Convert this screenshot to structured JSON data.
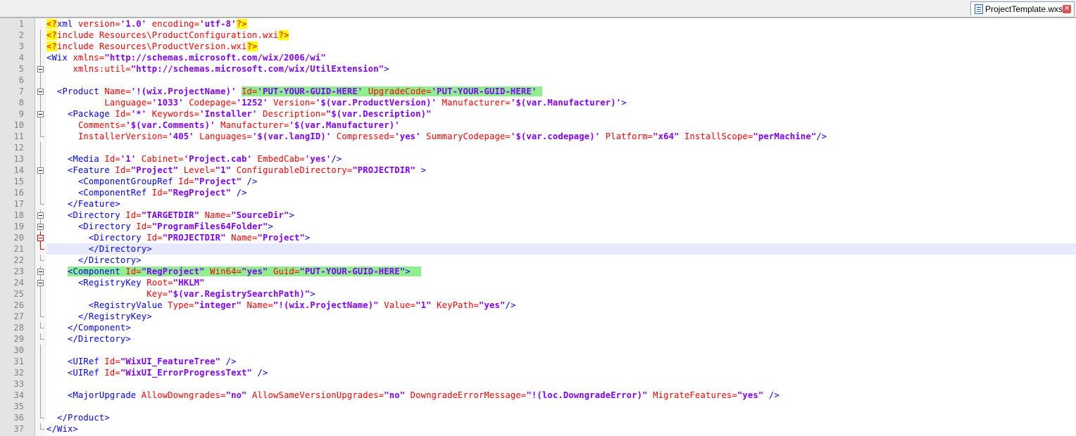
{
  "tab": {
    "filename": "ProjectTemplate.wxs",
    "file_icon": "document-icon",
    "close_icon": "close-icon"
  },
  "colors": {
    "tag": "#0000ff",
    "attribute": "#ff0000",
    "value": "#8000ff",
    "pi_background": "#ffff00",
    "highlight": "#90ee90",
    "current_line": "#e8e8ff"
  },
  "current_line": 21,
  "lines": [
    {
      "n": "1",
      "fold": "none",
      "indent": "",
      "tokens": [
        {
          "t": "<?",
          "c": "pi"
        },
        {
          "t": "xml ",
          "c": "tag"
        },
        {
          "t": "version=",
          "c": "attr"
        },
        {
          "t": "'1.0'",
          "c": "val"
        },
        {
          "t": " encoding=",
          "c": "attr"
        },
        {
          "t": "'utf-8'",
          "c": "val"
        },
        {
          "t": "?>",
          "c": "pi"
        }
      ]
    },
    {
      "n": "2",
      "fold": "none",
      "indent": "",
      "tokens": [
        {
          "t": "<?",
          "c": "pi"
        },
        {
          "t": "include Resources\\ProductConfiguration.wxi",
          "c": "attr"
        },
        {
          "t": "?>",
          "c": "pi"
        }
      ]
    },
    {
      "n": "3",
      "fold": "none",
      "indent": "",
      "tokens": [
        {
          "t": "<?",
          "c": "pi"
        },
        {
          "t": "include Resources\\ProductVersion.wxi",
          "c": "attr"
        },
        {
          "t": "?>",
          "c": "pi"
        }
      ]
    },
    {
      "n": "4",
      "fold": "none",
      "indent": "",
      "tokens": [
        {
          "t": "<Wix ",
          "c": "tag"
        },
        {
          "t": "xmlns=",
          "c": "attr"
        },
        {
          "t": "\"http://schemas.microsoft.com/wix/2006/wi\"",
          "c": "val"
        }
      ]
    },
    {
      "n": "5",
      "fold": "box",
      "indent": "     ",
      "tokens": [
        {
          "t": "xmlns:util=",
          "c": "attr"
        },
        {
          "t": "\"http://schemas.microsoft.com/wix/UtilExtension\"",
          "c": "val"
        },
        {
          "t": ">",
          "c": "tag"
        }
      ]
    },
    {
      "n": "6",
      "fold": "line",
      "indent": "",
      "tokens": []
    },
    {
      "n": "7",
      "fold": "box",
      "indent": "  ",
      "tokens": [
        {
          "t": "<Product ",
          "c": "tag"
        },
        {
          "t": "Name=",
          "c": "attr"
        },
        {
          "t": "'!(wix.ProjectName)'",
          "c": "val"
        },
        {
          "t": " ",
          "c": "txt"
        },
        {
          "t": "Id=",
          "c": "attr",
          "hl": true
        },
        {
          "t": "'PUT-YOUR-GUID-HERE'",
          "c": "val",
          "hl": true
        },
        {
          "t": " UpgradeCode=",
          "c": "attr",
          "hl": true
        },
        {
          "t": "'PUT-YOUR-GUID-HERE'",
          "c": "val",
          "hl": true
        },
        {
          "t": " ",
          "c": "txt",
          "hl": true
        }
      ]
    },
    {
      "n": "8",
      "fold": "line",
      "indent": "           ",
      "tokens": [
        {
          "t": "Language=",
          "c": "attr"
        },
        {
          "t": "'1033'",
          "c": "val"
        },
        {
          "t": " Codepage=",
          "c": "attr"
        },
        {
          "t": "'1252'",
          "c": "val"
        },
        {
          "t": " Version=",
          "c": "attr"
        },
        {
          "t": "'$(var.ProductVersion)'",
          "c": "val"
        },
        {
          "t": " Manufacturer=",
          "c": "attr"
        },
        {
          "t": "'$(var.Manufacturer)'",
          "c": "val"
        },
        {
          "t": ">",
          "c": "tag"
        }
      ]
    },
    {
      "n": "9",
      "fold": "box",
      "indent": "    ",
      "tokens": [
        {
          "t": "<Package ",
          "c": "tag"
        },
        {
          "t": "Id=",
          "c": "attr"
        },
        {
          "t": "'*'",
          "c": "val"
        },
        {
          "t": " Keywords=",
          "c": "attr"
        },
        {
          "t": "'Installer'",
          "c": "val"
        },
        {
          "t": " Description=",
          "c": "attr"
        },
        {
          "t": "\"$(var.Description)\"",
          "c": "val"
        }
      ]
    },
    {
      "n": "10",
      "fold": "line",
      "indent": "      ",
      "tokens": [
        {
          "t": "Comments=",
          "c": "attr"
        },
        {
          "t": "'$(var.Comments)'",
          "c": "val"
        },
        {
          "t": " Manufacturer=",
          "c": "attr"
        },
        {
          "t": "'$(var.Manufacturer)'",
          "c": "val"
        }
      ]
    },
    {
      "n": "11",
      "fold": "end",
      "indent": "      ",
      "tokens": [
        {
          "t": "InstallerVersion=",
          "c": "attr"
        },
        {
          "t": "'405'",
          "c": "val"
        },
        {
          "t": " Languages=",
          "c": "attr"
        },
        {
          "t": "'$(var.langID)'",
          "c": "val"
        },
        {
          "t": " Compressed=",
          "c": "attr"
        },
        {
          "t": "'yes'",
          "c": "val"
        },
        {
          "t": " SummaryCodepage=",
          "c": "attr"
        },
        {
          "t": "'$(var.codepage)'",
          "c": "val"
        },
        {
          "t": " Platform=",
          "c": "attr"
        },
        {
          "t": "\"x64\"",
          "c": "val"
        },
        {
          "t": " InstallScope=",
          "c": "attr"
        },
        {
          "t": "\"perMachine\"",
          "c": "val"
        },
        {
          "t": "/>",
          "c": "tag"
        }
      ]
    },
    {
      "n": "12",
      "fold": "line",
      "indent": "",
      "tokens": []
    },
    {
      "n": "13",
      "fold": "line",
      "indent": "    ",
      "tokens": [
        {
          "t": "<Media ",
          "c": "tag"
        },
        {
          "t": "Id=",
          "c": "attr"
        },
        {
          "t": "'1'",
          "c": "val"
        },
        {
          "t": " Cabinet=",
          "c": "attr"
        },
        {
          "t": "'Project.cab'",
          "c": "val"
        },
        {
          "t": " EmbedCab=",
          "c": "attr"
        },
        {
          "t": "'yes'",
          "c": "val"
        },
        {
          "t": "/>",
          "c": "tag"
        }
      ]
    },
    {
      "n": "14",
      "fold": "box",
      "indent": "    ",
      "tokens": [
        {
          "t": "<Feature ",
          "c": "tag"
        },
        {
          "t": "Id=",
          "c": "attr"
        },
        {
          "t": "\"Project\"",
          "c": "val"
        },
        {
          "t": " Level=",
          "c": "attr"
        },
        {
          "t": "\"1\"",
          "c": "val"
        },
        {
          "t": " ConfigurableDirectory=",
          "c": "attr"
        },
        {
          "t": "\"PROJECTDIR\"",
          "c": "val"
        },
        {
          "t": " >",
          "c": "tag"
        }
      ]
    },
    {
      "n": "15",
      "fold": "line",
      "indent": "      ",
      "tokens": [
        {
          "t": "<ComponentGroupRef ",
          "c": "tag"
        },
        {
          "t": "Id=",
          "c": "attr"
        },
        {
          "t": "\"Project\"",
          "c": "val"
        },
        {
          "t": " />",
          "c": "tag"
        }
      ]
    },
    {
      "n": "16",
      "fold": "line",
      "indent": "      ",
      "tokens": [
        {
          "t": "<ComponentRef ",
          "c": "tag"
        },
        {
          "t": "Id=",
          "c": "attr"
        },
        {
          "t": "\"RegProject\"",
          "c": "val"
        },
        {
          "t": " />",
          "c": "tag"
        }
      ]
    },
    {
      "n": "17",
      "fold": "end",
      "indent": "    ",
      "tokens": [
        {
          "t": "</Feature>",
          "c": "tag"
        }
      ]
    },
    {
      "n": "18",
      "fold": "box",
      "indent": "    ",
      "tokens": [
        {
          "t": "<Directory ",
          "c": "tag"
        },
        {
          "t": "Id=",
          "c": "attr"
        },
        {
          "t": "\"TARGETDIR\"",
          "c": "val"
        },
        {
          "t": " Name=",
          "c": "attr"
        },
        {
          "t": "\"SourceDir\"",
          "c": "val"
        },
        {
          "t": ">",
          "c": "tag"
        }
      ]
    },
    {
      "n": "19",
      "fold": "box",
      "indent": "      ",
      "tokens": [
        {
          "t": "<Directory ",
          "c": "tag"
        },
        {
          "t": "Id=",
          "c": "attr"
        },
        {
          "t": "\"ProgramFiles64Folder\"",
          "c": "val"
        },
        {
          "t": ">",
          "c": "tag"
        }
      ]
    },
    {
      "n": "20",
      "fold": "boxred",
      "indent": "        ",
      "tokens": [
        {
          "t": "<Directory ",
          "c": "tag"
        },
        {
          "t": "Id=",
          "c": "attr"
        },
        {
          "t": "\"PROJECTDIR\"",
          "c": "val"
        },
        {
          "t": " Name=",
          "c": "attr"
        },
        {
          "t": "\"Project\"",
          "c": "val"
        },
        {
          "t": ">",
          "c": "tag"
        }
      ]
    },
    {
      "n": "21",
      "fold": "endred",
      "indent": "        ",
      "tokens": [
        {
          "t": "</Directory>",
          "c": "tag"
        }
      ]
    },
    {
      "n": "22",
      "fold": "end",
      "indent": "      ",
      "tokens": [
        {
          "t": "</Directory>",
          "c": "tag"
        }
      ]
    },
    {
      "n": "23",
      "fold": "box",
      "indent": "    ",
      "tokens": [
        {
          "t": "<Component ",
          "c": "tag",
          "hl": true
        },
        {
          "t": "Id=",
          "c": "attr",
          "hl": true
        },
        {
          "t": "\"RegProject\"",
          "c": "val",
          "hl": true
        },
        {
          "t": " Win64=",
          "c": "attr",
          "hl": true
        },
        {
          "t": "\"yes\"",
          "c": "val",
          "hl": true
        },
        {
          "t": " Guid=",
          "c": "attr",
          "hl": true
        },
        {
          "t": "\"PUT-YOUR-GUID-HERE\"",
          "c": "val",
          "hl": true
        },
        {
          "t": ">",
          "c": "tag",
          "hl": true
        },
        {
          "t": "  ",
          "c": "txt",
          "hl": true
        }
      ]
    },
    {
      "n": "24",
      "fold": "box",
      "indent": "      ",
      "tokens": [
        {
          "t": "<RegistryKey ",
          "c": "tag"
        },
        {
          "t": "Root=",
          "c": "attr"
        },
        {
          "t": "\"HKLM\"",
          "c": "val"
        }
      ]
    },
    {
      "n": "25",
      "fold": "line",
      "indent": "                   ",
      "tokens": [
        {
          "t": "Key=",
          "c": "attr"
        },
        {
          "t": "\"$(var.RegistrySearchPath)\"",
          "c": "val"
        },
        {
          "t": ">",
          "c": "tag"
        }
      ]
    },
    {
      "n": "26",
      "fold": "line",
      "indent": "        ",
      "tokens": [
        {
          "t": "<RegistryValue ",
          "c": "tag"
        },
        {
          "t": "Type=",
          "c": "attr"
        },
        {
          "t": "\"integer\"",
          "c": "val"
        },
        {
          "t": " Name=",
          "c": "attr"
        },
        {
          "t": "\"!(wix.ProjectName)\"",
          "c": "val"
        },
        {
          "t": " Value=",
          "c": "attr"
        },
        {
          "t": "\"1\"",
          "c": "val"
        },
        {
          "t": " KeyPath=",
          "c": "attr"
        },
        {
          "t": "\"yes\"",
          "c": "val"
        },
        {
          "t": "/>",
          "c": "tag"
        }
      ]
    },
    {
      "n": "27",
      "fold": "end",
      "indent": "      ",
      "tokens": [
        {
          "t": "</RegistryKey>",
          "c": "tag"
        }
      ]
    },
    {
      "n": "28",
      "fold": "end",
      "indent": "    ",
      "tokens": [
        {
          "t": "</Component>",
          "c": "tag"
        }
      ]
    },
    {
      "n": "29",
      "fold": "end",
      "indent": "    ",
      "tokens": [
        {
          "t": "</Directory>",
          "c": "tag"
        }
      ]
    },
    {
      "n": "30",
      "fold": "line",
      "indent": "",
      "tokens": []
    },
    {
      "n": "31",
      "fold": "line",
      "indent": "    ",
      "tokens": [
        {
          "t": "<UIRef ",
          "c": "tag"
        },
        {
          "t": "Id=",
          "c": "attr"
        },
        {
          "t": "\"WixUI_FeatureTree\"",
          "c": "val"
        },
        {
          "t": " />",
          "c": "tag"
        }
      ]
    },
    {
      "n": "32",
      "fold": "line",
      "indent": "    ",
      "tokens": [
        {
          "t": "<UIRef ",
          "c": "tag"
        },
        {
          "t": "Id=",
          "c": "attr"
        },
        {
          "t": "\"WixUI_ErrorProgressText\"",
          "c": "val"
        },
        {
          "t": " />",
          "c": "tag"
        }
      ]
    },
    {
      "n": "33",
      "fold": "line",
      "indent": "",
      "tokens": []
    },
    {
      "n": "34",
      "fold": "line",
      "indent": "    ",
      "tokens": [
        {
          "t": "<MajorUpgrade ",
          "c": "tag"
        },
        {
          "t": "AllowDowngrades=",
          "c": "attr"
        },
        {
          "t": "\"no\"",
          "c": "val"
        },
        {
          "t": " AllowSameVersionUpgrades=",
          "c": "attr"
        },
        {
          "t": "\"no\"",
          "c": "val"
        },
        {
          "t": " DowngradeErrorMessage=",
          "c": "attr"
        },
        {
          "t": "\"!(loc.DowngradeError)\"",
          "c": "val"
        },
        {
          "t": " MigrateFeatures=",
          "c": "attr"
        },
        {
          "t": "\"yes\"",
          "c": "val"
        },
        {
          "t": " />",
          "c": "tag"
        }
      ]
    },
    {
      "n": "35",
      "fold": "line",
      "indent": "",
      "tokens": []
    },
    {
      "n": "36",
      "fold": "end",
      "indent": "  ",
      "tokens": [
        {
          "t": "</Product>",
          "c": "tag"
        }
      ]
    },
    {
      "n": "37",
      "fold": "end",
      "indent": "",
      "tokens": [
        {
          "t": "</Wix>",
          "c": "tag"
        }
      ]
    }
  ]
}
